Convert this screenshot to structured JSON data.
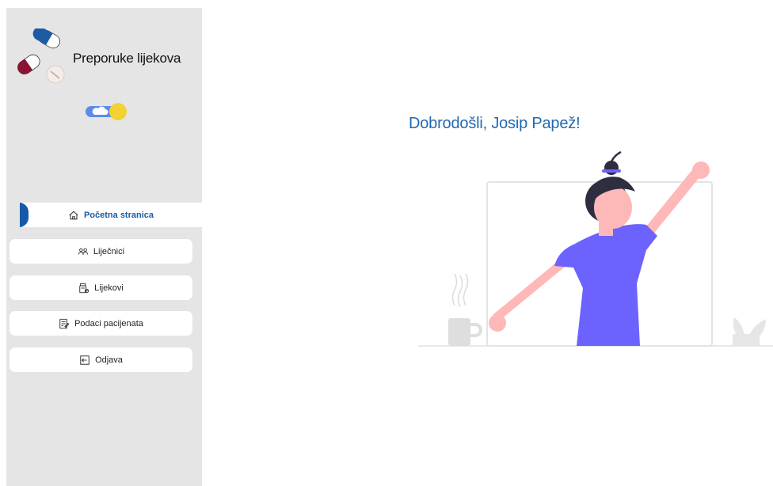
{
  "app": {
    "title": "Preporuke lijekova"
  },
  "sidebar": {
    "items": [
      {
        "label": "Početna stranica",
        "icon": "home-icon",
        "active": true
      },
      {
        "label": "Liječnici",
        "icon": "doctors-icon",
        "active": false
      },
      {
        "label": "Lijekovi",
        "icon": "medicine-icon",
        "active": false
      },
      {
        "label": "Podaci pacijenata",
        "icon": "patient-data-icon",
        "active": false
      },
      {
        "label": "Odjava",
        "icon": "logout-icon",
        "active": false
      }
    ]
  },
  "main": {
    "welcome": "Dobrodošli, Josip Papež!"
  },
  "colors": {
    "sidebar_bg": "#e5e5e5",
    "accent_blue": "#1759a6",
    "heading_blue": "#2169b2",
    "pill_red": "#8c1432",
    "illustration_purple": "#6c63ff",
    "skin": "#ffb8b8",
    "toggle_yellow": "#f2d230"
  }
}
